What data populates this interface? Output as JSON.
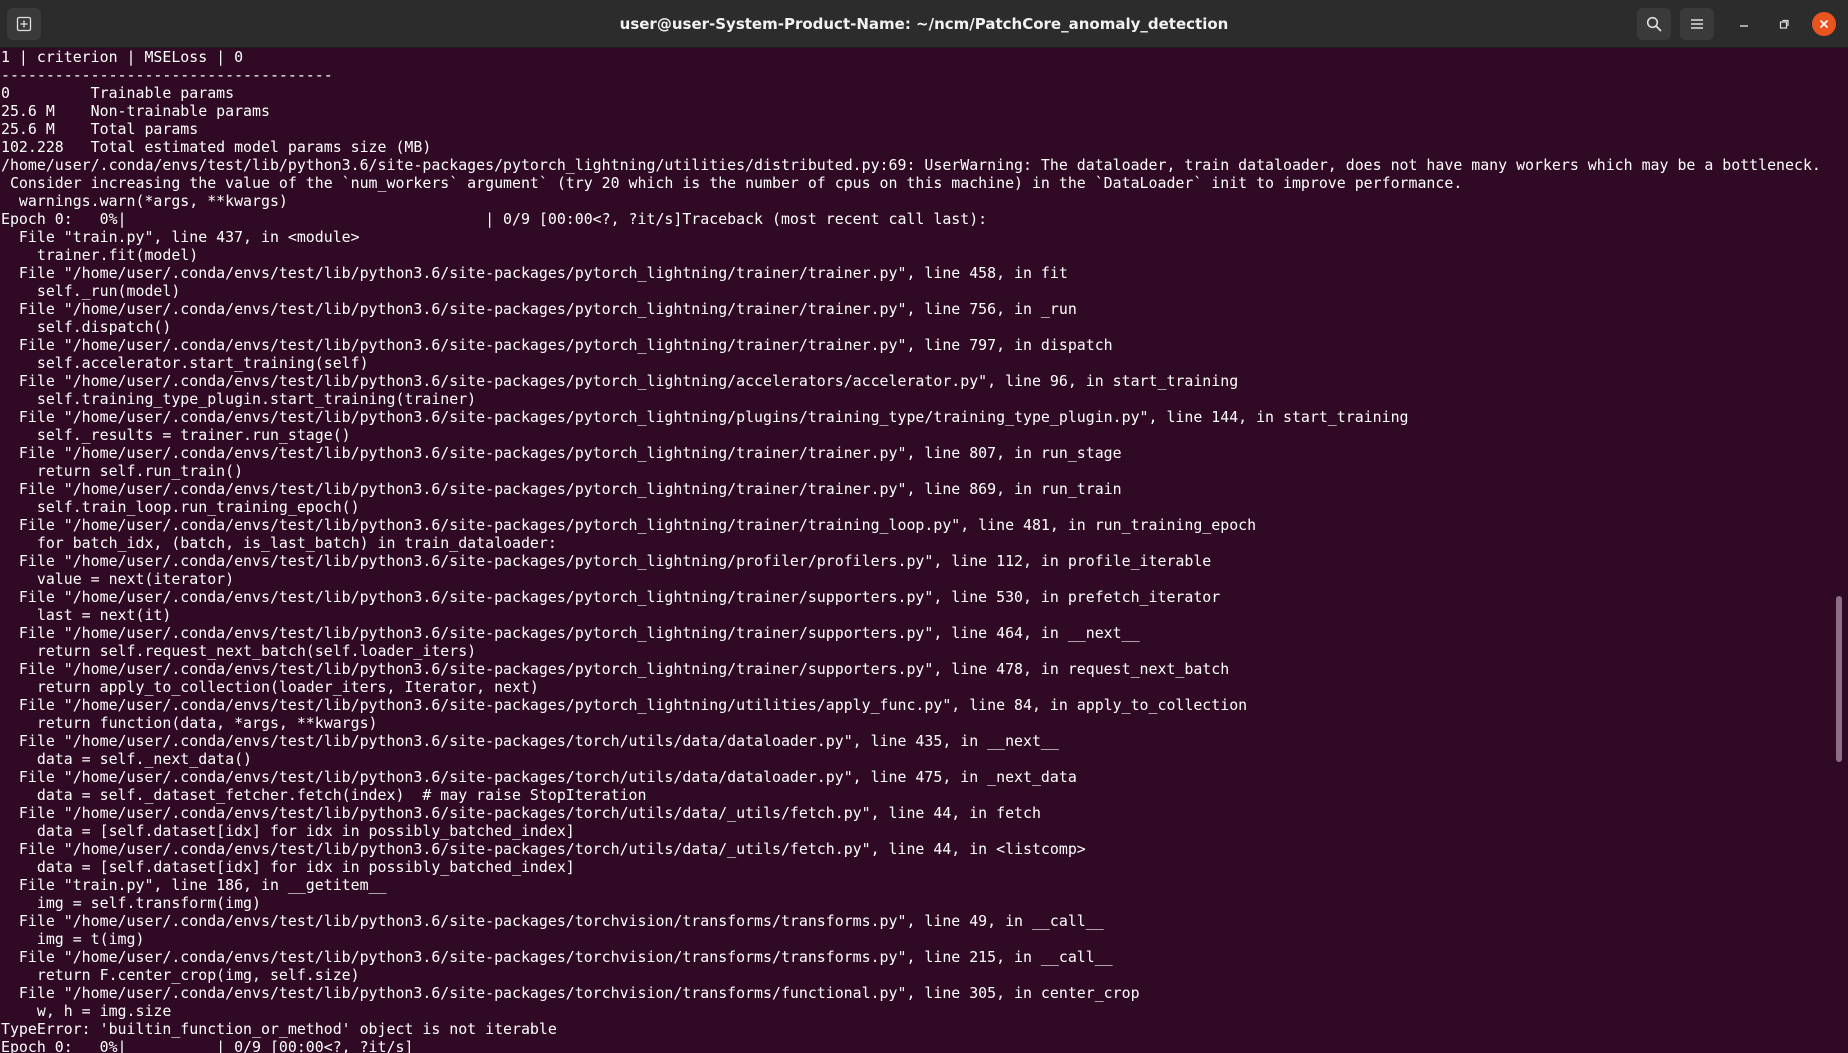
{
  "window": {
    "title": "user@user-System-Product-Name: ~/ncm/PatchCore_anomaly_detection"
  },
  "icons": {
    "new_tab": "new-tab-icon",
    "search": "search-icon",
    "menu": "hamburger-menu-icon",
    "minimize": "minimize-icon",
    "maximize": "maximize-icon",
    "close": "close-icon"
  },
  "colors": {
    "terminal_bg": "#300a24",
    "titlebar_bg": "#2c2c2c",
    "close_button": "#e95420",
    "text": "#ffffff"
  },
  "terminal": {
    "lines": [
      "1 | criterion | MSELoss | 0",
      "-------------------------------------",
      "0         Trainable params",
      "25.6 M    Non-trainable params",
      "25.6 M    Total params",
      "102.228   Total estimated model params size (MB)",
      "/home/user/.conda/envs/test/lib/python3.6/site-packages/pytorch_lightning/utilities/distributed.py:69: UserWarning: The dataloader, train dataloader, does not have many workers which may be a bottleneck.",
      " Consider increasing the value of the `num_workers` argument` (try 20 which is the number of cpus on this machine) in the `DataLoader` init to improve performance.",
      "  warnings.warn(*args, **kwargs)",
      "Epoch 0:   0%|                                        | 0/9 [00:00<?, ?it/s]Traceback (most recent call last):",
      "  File \"train.py\", line 437, in <module>",
      "    trainer.fit(model)",
      "  File \"/home/user/.conda/envs/test/lib/python3.6/site-packages/pytorch_lightning/trainer/trainer.py\", line 458, in fit",
      "    self._run(model)",
      "  File \"/home/user/.conda/envs/test/lib/python3.6/site-packages/pytorch_lightning/trainer/trainer.py\", line 756, in _run",
      "    self.dispatch()",
      "  File \"/home/user/.conda/envs/test/lib/python3.6/site-packages/pytorch_lightning/trainer/trainer.py\", line 797, in dispatch",
      "    self.accelerator.start_training(self)",
      "  File \"/home/user/.conda/envs/test/lib/python3.6/site-packages/pytorch_lightning/accelerators/accelerator.py\", line 96, in start_training",
      "    self.training_type_plugin.start_training(trainer)",
      "  File \"/home/user/.conda/envs/test/lib/python3.6/site-packages/pytorch_lightning/plugins/training_type/training_type_plugin.py\", line 144, in start_training",
      "    self._results = trainer.run_stage()",
      "  File \"/home/user/.conda/envs/test/lib/python3.6/site-packages/pytorch_lightning/trainer/trainer.py\", line 807, in run_stage",
      "    return self.run_train()",
      "  File \"/home/user/.conda/envs/test/lib/python3.6/site-packages/pytorch_lightning/trainer/trainer.py\", line 869, in run_train",
      "    self.train_loop.run_training_epoch()",
      "  File \"/home/user/.conda/envs/test/lib/python3.6/site-packages/pytorch_lightning/trainer/training_loop.py\", line 481, in run_training_epoch",
      "    for batch_idx, (batch, is_last_batch) in train_dataloader:",
      "  File \"/home/user/.conda/envs/test/lib/python3.6/site-packages/pytorch_lightning/profiler/profilers.py\", line 112, in profile_iterable",
      "    value = next(iterator)",
      "  File \"/home/user/.conda/envs/test/lib/python3.6/site-packages/pytorch_lightning/trainer/supporters.py\", line 530, in prefetch_iterator",
      "    last = next(it)",
      "  File \"/home/user/.conda/envs/test/lib/python3.6/site-packages/pytorch_lightning/trainer/supporters.py\", line 464, in __next__",
      "    return self.request_next_batch(self.loader_iters)",
      "  File \"/home/user/.conda/envs/test/lib/python3.6/site-packages/pytorch_lightning/trainer/supporters.py\", line 478, in request_next_batch",
      "    return apply_to_collection(loader_iters, Iterator, next)",
      "  File \"/home/user/.conda/envs/test/lib/python3.6/site-packages/pytorch_lightning/utilities/apply_func.py\", line 84, in apply_to_collection",
      "    return function(data, *args, **kwargs)",
      "  File \"/home/user/.conda/envs/test/lib/python3.6/site-packages/torch/utils/data/dataloader.py\", line 435, in __next__",
      "    data = self._next_data()",
      "  File \"/home/user/.conda/envs/test/lib/python3.6/site-packages/torch/utils/data/dataloader.py\", line 475, in _next_data",
      "    data = self._dataset_fetcher.fetch(index)  # may raise StopIteration",
      "  File \"/home/user/.conda/envs/test/lib/python3.6/site-packages/torch/utils/data/_utils/fetch.py\", line 44, in fetch",
      "    data = [self.dataset[idx] for idx in possibly_batched_index]",
      "  File \"/home/user/.conda/envs/test/lib/python3.6/site-packages/torch/utils/data/_utils/fetch.py\", line 44, in <listcomp>",
      "    data = [self.dataset[idx] for idx in possibly_batched_index]",
      "  File \"train.py\", line 186, in __getitem__",
      "    img = self.transform(img)",
      "  File \"/home/user/.conda/envs/test/lib/python3.6/site-packages/torchvision/transforms/transforms.py\", line 49, in __call__",
      "    img = t(img)",
      "  File \"/home/user/.conda/envs/test/lib/python3.6/site-packages/torchvision/transforms/transforms.py\", line 215, in __call__",
      "    return F.center_crop(img, self.size)",
      "  File \"/home/user/.conda/envs/test/lib/python3.6/site-packages/torchvision/transforms/functional.py\", line 305, in center_crop",
      "    w, h = img.size",
      "TypeError: 'builtin_function_or_method' object is not iterable",
      "Epoch 0:   0%|          | 0/9 [00:00<?, ?it/s]"
    ]
  }
}
